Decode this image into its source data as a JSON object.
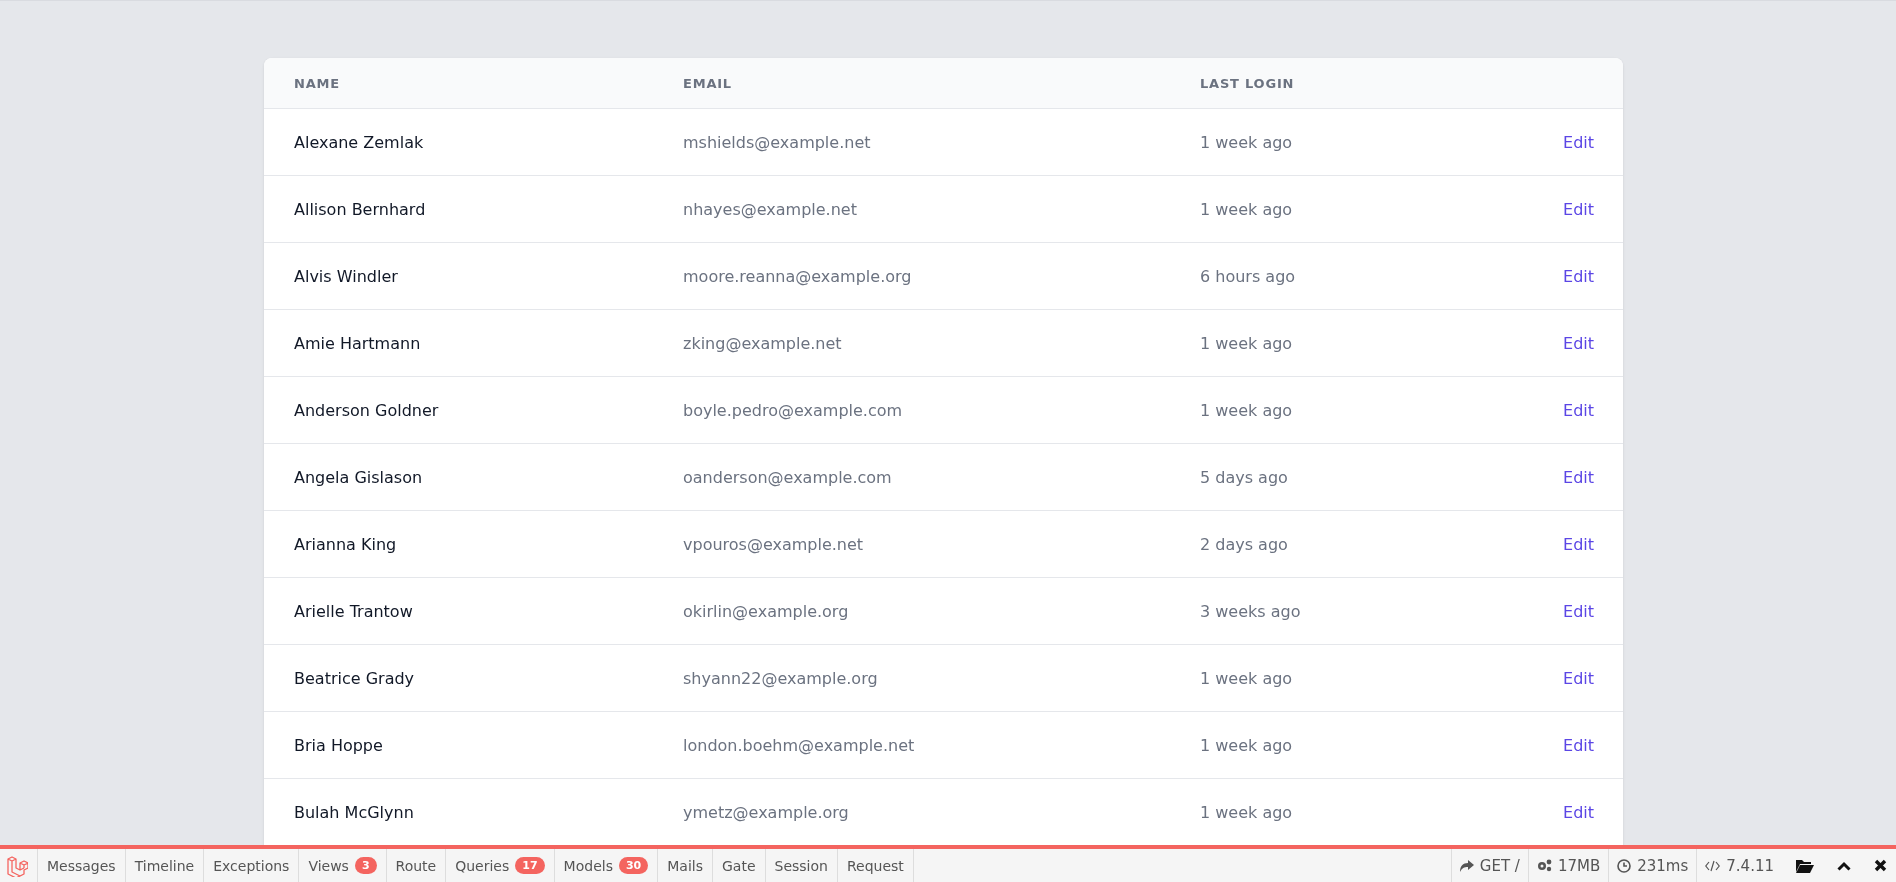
{
  "table": {
    "columns": [
      "NAME",
      "EMAIL",
      "LAST LOGIN"
    ],
    "rows": [
      {
        "name": "Alexane Zemlak",
        "email": "mshields@example.net",
        "last_login": "1 week ago",
        "action": "Edit"
      },
      {
        "name": "Allison Bernhard",
        "email": "nhayes@example.net",
        "last_login": "1 week ago",
        "action": "Edit"
      },
      {
        "name": "Alvis Windler",
        "email": "moore.reanna@example.org",
        "last_login": "6 hours ago",
        "action": "Edit"
      },
      {
        "name": "Amie Hartmann",
        "email": "zking@example.net",
        "last_login": "1 week ago",
        "action": "Edit"
      },
      {
        "name": "Anderson Goldner",
        "email": "boyle.pedro@example.com",
        "last_login": "1 week ago",
        "action": "Edit"
      },
      {
        "name": "Angela Gislason",
        "email": "oanderson@example.com",
        "last_login": "5 days ago",
        "action": "Edit"
      },
      {
        "name": "Arianna King",
        "email": "vpouros@example.net",
        "last_login": "2 days ago",
        "action": "Edit"
      },
      {
        "name": "Arielle Trantow",
        "email": "okirlin@example.org",
        "last_login": "3 weeks ago",
        "action": "Edit"
      },
      {
        "name": "Beatrice Grady",
        "email": "shyann22@example.org",
        "last_login": "1 week ago",
        "action": "Edit"
      },
      {
        "name": "Bria Hoppe",
        "email": "london.boehm@example.net",
        "last_login": "1 week ago",
        "action": "Edit"
      },
      {
        "name": "Bulah McGlynn",
        "email": "ymetz@example.org",
        "last_login": "1 week ago",
        "action": "Edit"
      }
    ]
  },
  "debugbar": {
    "tabs": [
      {
        "label": "Messages"
      },
      {
        "label": "Timeline"
      },
      {
        "label": "Exceptions"
      },
      {
        "label": "Views",
        "badge": "3"
      },
      {
        "label": "Route"
      },
      {
        "label": "Queries",
        "badge": "17"
      },
      {
        "label": "Models",
        "badge": "30"
      },
      {
        "label": "Mails"
      },
      {
        "label": "Gate"
      },
      {
        "label": "Session"
      },
      {
        "label": "Request"
      }
    ],
    "indicators": [
      {
        "kind": "request",
        "text": "GET /"
      },
      {
        "kind": "memory",
        "text": "17MB"
      },
      {
        "kind": "time",
        "text": "231ms"
      },
      {
        "kind": "version",
        "text": "7.4.11"
      }
    ]
  }
}
